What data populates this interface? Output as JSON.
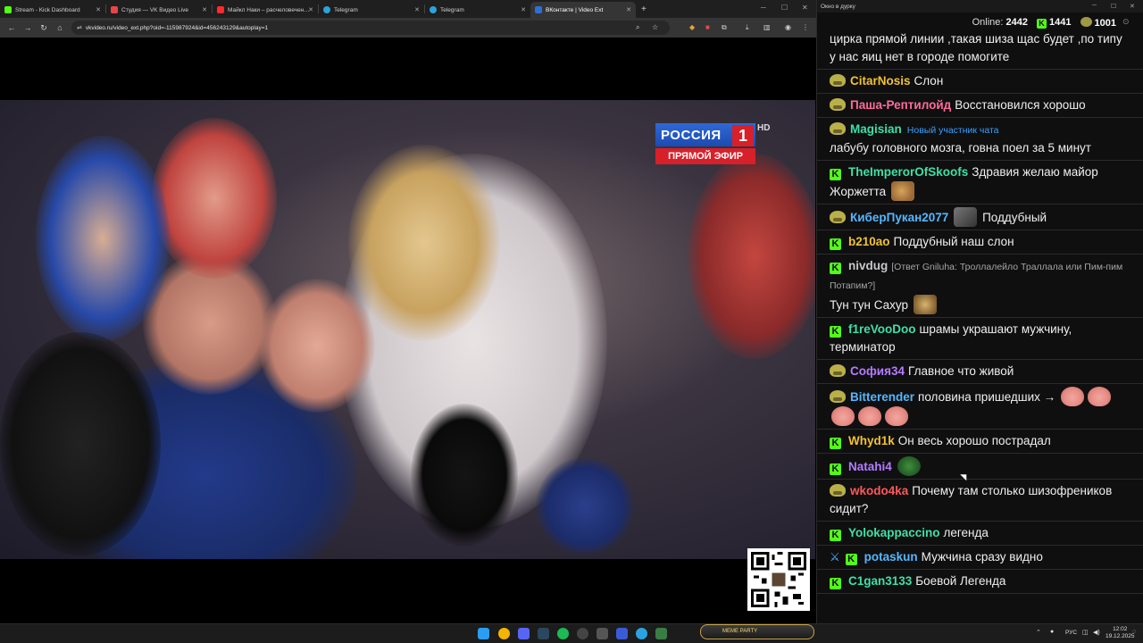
{
  "browser": {
    "tabs": [
      {
        "title": "Stream - Kick Dashboard",
        "color": "#53fc18"
      },
      {
        "title": "Студия — VK Видео Live",
        "color": "#e8454a"
      },
      {
        "title": "Майкл Наки – расчеловечен…",
        "color": "#ff2a2a"
      },
      {
        "title": "Telegram",
        "color": "#2aa3df"
      },
      {
        "title": "Telegram",
        "color": "#2aa3df"
      },
      {
        "title": "ВКонтакте | Video Ext",
        "color": "#2f6fd6"
      }
    ],
    "url": "vkvideo.ru/video_ext.php?oid=-115987924&id=456243129&autoplay=1"
  },
  "video": {
    "channel_logo": "РОССИЯ",
    "channel_number": "1",
    "hd": "HD",
    "live_label": "ПРЯМОЙ ЭФИР"
  },
  "chat": {
    "window_title": "Окно в дурку",
    "online_label": "Online:",
    "online_count": "2442",
    "kick_count": "1441",
    "frog_count": "1001",
    "messages": [
      {
        "badge": "none",
        "user": "",
        "user_color": "#8fd0ff",
        "text": "цирка прямой линии ,такая шиза щас будет ,по типу у нас яиц нет в городе помогите"
      },
      {
        "badge": "frog",
        "user": "CitarNosis",
        "user_color": "#f2c230",
        "text": "Слон"
      },
      {
        "badge": "frog",
        "user": "Паша-Рептилойд",
        "user_color": "#ff6b9a",
        "text": "Восстановился хорошо"
      },
      {
        "badge": "frog",
        "user": "Magisian",
        "user_color": "#3fe0a6",
        "newbie": "Новый участник чата",
        "text": "лабубу головного мозга, говна поел за 5 минут"
      },
      {
        "badge": "kick",
        "user": "TheImperorOfSkoofs",
        "user_color": "#3fe0a6",
        "text": "Здравия желаю майор Жоржетта"
      },
      {
        "badge": "frog",
        "user": "КиберПукан2077",
        "user_color": "#55b7ff",
        "text": "Поддубный"
      },
      {
        "badge": "kick",
        "user": "b210ao",
        "user_color": "#f2c230",
        "text": "Поддубный наш слон"
      },
      {
        "badge": "kick",
        "user": "nivdug",
        "user_color": "#c8c8cc",
        "reply": "[Ответ Gniluha: Троллалейло Траллала или Пим-пим Потапим?]",
        "text": "Тун тун Сахур"
      },
      {
        "badge": "kick",
        "user": "f1reVooDoo",
        "user_color": "#3fe0a6",
        "text": "шрамы украшают мужчину, терминатор"
      },
      {
        "badge": "frog",
        "user": "София34",
        "user_color": "#b57bff",
        "text": "Главное что живой"
      },
      {
        "badge": "frog",
        "user": "Bitterender",
        "user_color": "#55b7ff",
        "text": "половина пришедших →"
      },
      {
        "badge": "kick",
        "user": "Whyd1k",
        "user_color": "#f2c230",
        "text": "Он весь хорошо пострадал"
      },
      {
        "badge": "kick",
        "user": "Natahi4",
        "user_color": "#b57bff",
        "text": ""
      },
      {
        "badge": "frog",
        "user": "wkodo4ka",
        "user_color": "#ff5959",
        "text": "Почему там столько шизофреников сидит?"
      },
      {
        "badge": "kick",
        "user": "Yolokappaccino",
        "user_color": "#3fe0a6",
        "text": "легенда"
      },
      {
        "badge": "sword",
        "user": "potaskun",
        "user_color": "#55b7ff",
        "text": "Мужчина сразу видно"
      },
      {
        "badge": "kick",
        "user": "C1gan3133",
        "user_color": "#3fe0a6",
        "text": "Боевой Легенда"
      }
    ]
  },
  "taskbar": {
    "meme_party": "MEME PARTY",
    "lang": "РУС",
    "time": "12:02",
    "date": "19.12.2025"
  }
}
